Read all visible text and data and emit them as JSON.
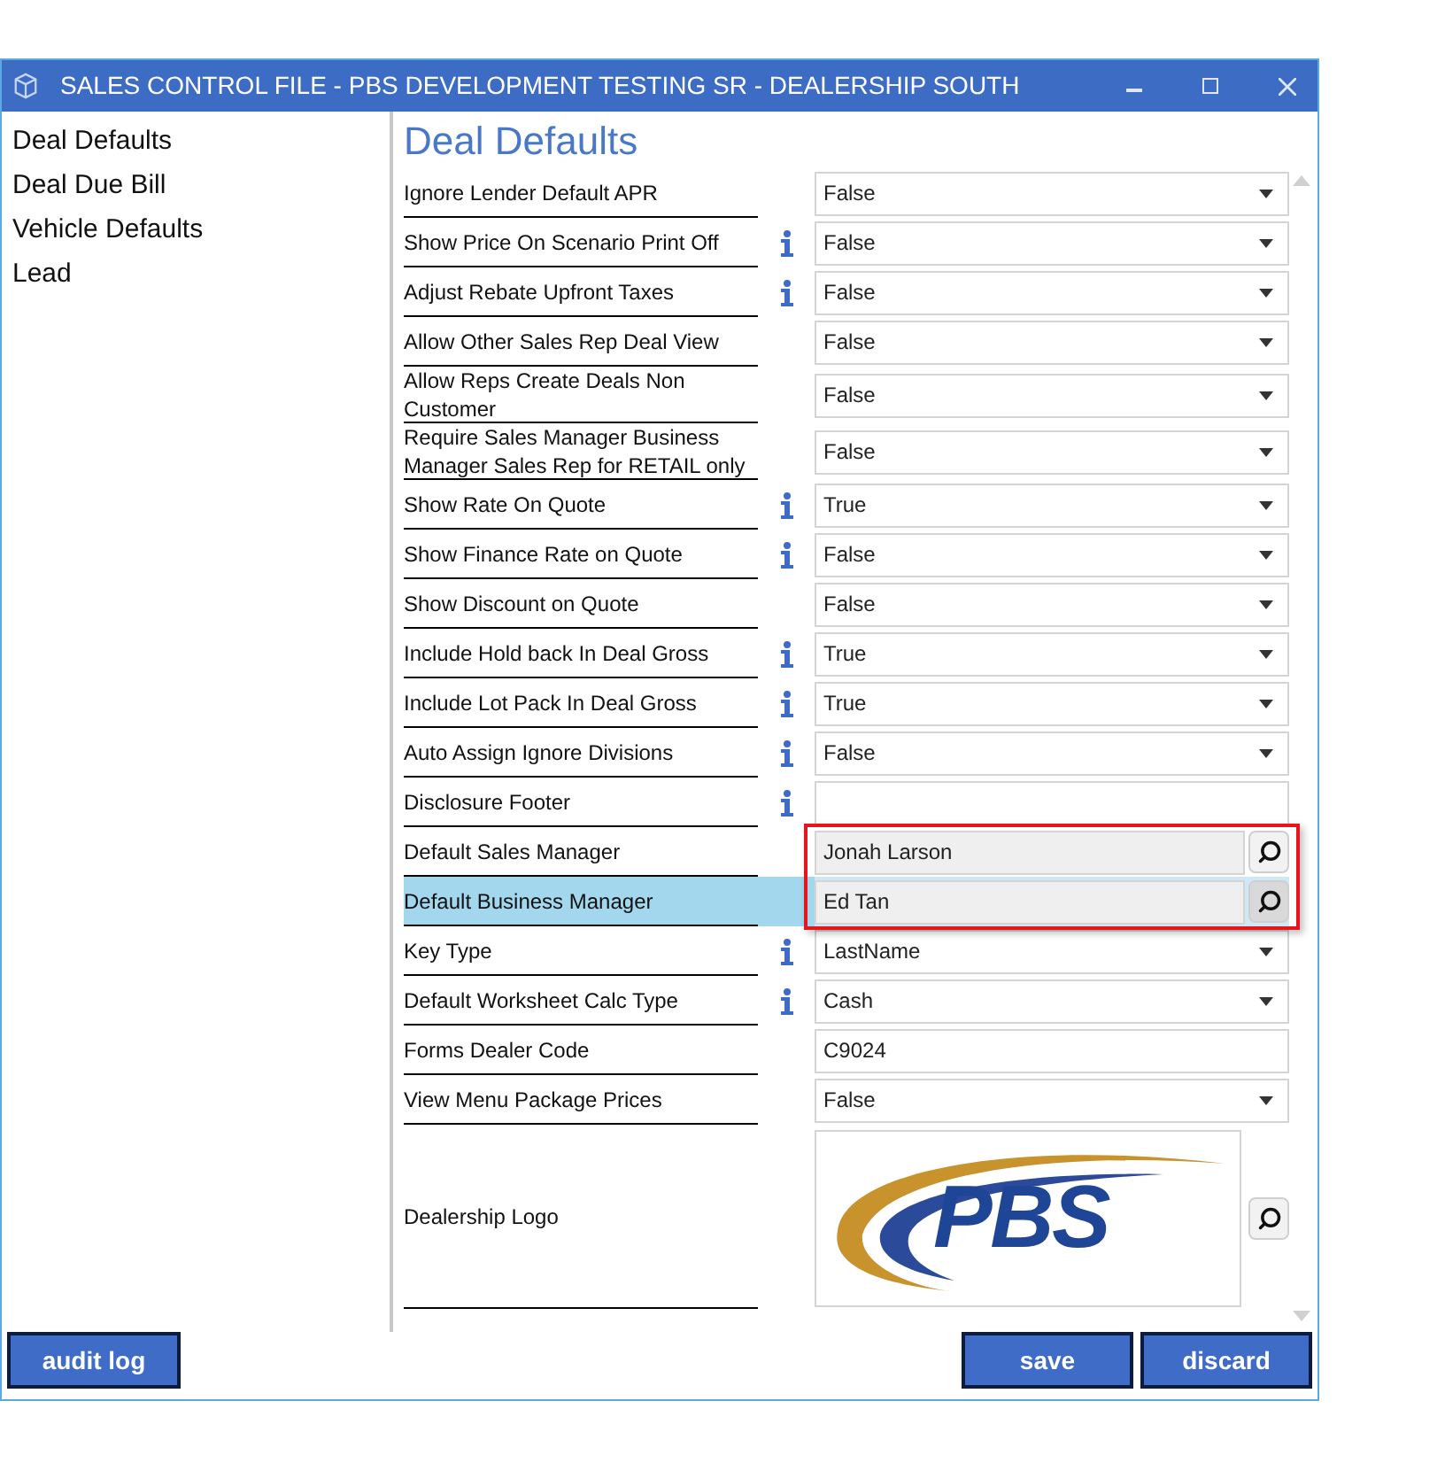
{
  "window": {
    "title": "SALES CONTROL FILE - PBS DEVELOPMENT TESTING SR - DEALERSHIP SOUTH"
  },
  "sidebar": {
    "items": [
      {
        "label": "Deal Defaults"
      },
      {
        "label": "Deal Due Bill"
      },
      {
        "label": "Vehicle Defaults"
      },
      {
        "label": "Lead"
      }
    ]
  },
  "section_title": "Deal Defaults",
  "rows": [
    {
      "label": "Ignore Lender Default APR",
      "kind": "select",
      "value": "False",
      "info": false,
      "selected": false,
      "highlighted": false
    },
    {
      "label": "Show Price On Scenario Print Off",
      "kind": "select",
      "value": "False",
      "info": true,
      "selected": false,
      "highlighted": false
    },
    {
      "label": "Adjust Rebate Upfront Taxes",
      "kind": "select",
      "value": "False",
      "info": true,
      "selected": false,
      "highlighted": false
    },
    {
      "label": "Allow Other Sales Rep Deal View",
      "kind": "select",
      "value": "False",
      "info": false,
      "selected": false,
      "highlighted": false
    },
    {
      "label": "Allow Reps Create Deals Non Customer",
      "kind": "select",
      "value": "False",
      "info": false,
      "selected": false,
      "highlighted": false
    },
    {
      "label": "Require Sales Manager Business Manager Sales Rep for RETAIL only",
      "kind": "select",
      "value": "False",
      "info": false,
      "selected": false,
      "highlighted": false
    },
    {
      "label": "Show Rate On Quote",
      "kind": "select",
      "value": "True",
      "info": true,
      "selected": false,
      "highlighted": false
    },
    {
      "label": "Show Finance Rate on Quote",
      "kind": "select",
      "value": "False",
      "info": true,
      "selected": false,
      "highlighted": false
    },
    {
      "label": "Show Discount on Quote",
      "kind": "select",
      "value": "False",
      "info": false,
      "selected": false,
      "highlighted": false
    },
    {
      "label": "Include Hold back In Deal Gross",
      "kind": "select",
      "value": "True",
      "info": true,
      "selected": false,
      "highlighted": false
    },
    {
      "label": "Include Lot Pack In Deal Gross",
      "kind": "select",
      "value": "True",
      "info": true,
      "selected": false,
      "highlighted": false
    },
    {
      "label": "Auto Assign Ignore Divisions",
      "kind": "select",
      "value": "False",
      "info": true,
      "selected": false,
      "highlighted": false
    },
    {
      "label": "Disclosure Footer",
      "kind": "text",
      "info": true,
      "selected": false,
      "highlighted": false
    },
    {
      "label": "Default Sales Manager",
      "kind": "lookup",
      "value": "Jonah Larson",
      "info": false,
      "selected": false,
      "highlighted": true
    },
    {
      "label": "Default Business Manager",
      "kind": "lookup",
      "value": "Ed Tan",
      "info": false,
      "selected": true,
      "highlighted": true
    },
    {
      "label": "Key Type",
      "kind": "select",
      "value": "LastName",
      "info": true,
      "selected": false,
      "highlighted": false
    },
    {
      "label": "Default Worksheet Calc Type",
      "kind": "select",
      "value": "Cash",
      "info": true,
      "selected": false,
      "highlighted": false
    },
    {
      "label": "Forms Dealer Code",
      "kind": "text",
      "value": "C9024",
      "info": false,
      "selected": false,
      "highlighted": false
    },
    {
      "label": "View Menu Package Prices",
      "kind": "select",
      "value": "False",
      "info": false,
      "selected": false,
      "highlighted": false
    },
    {
      "label": "Dealership Logo",
      "kind": "logo",
      "logo_text": "PBS",
      "info": false,
      "selected": false,
      "highlighted": false
    }
  ],
  "buttons": {
    "left": [
      "audit log"
    ],
    "right": [
      "save",
      "discard"
    ]
  }
}
